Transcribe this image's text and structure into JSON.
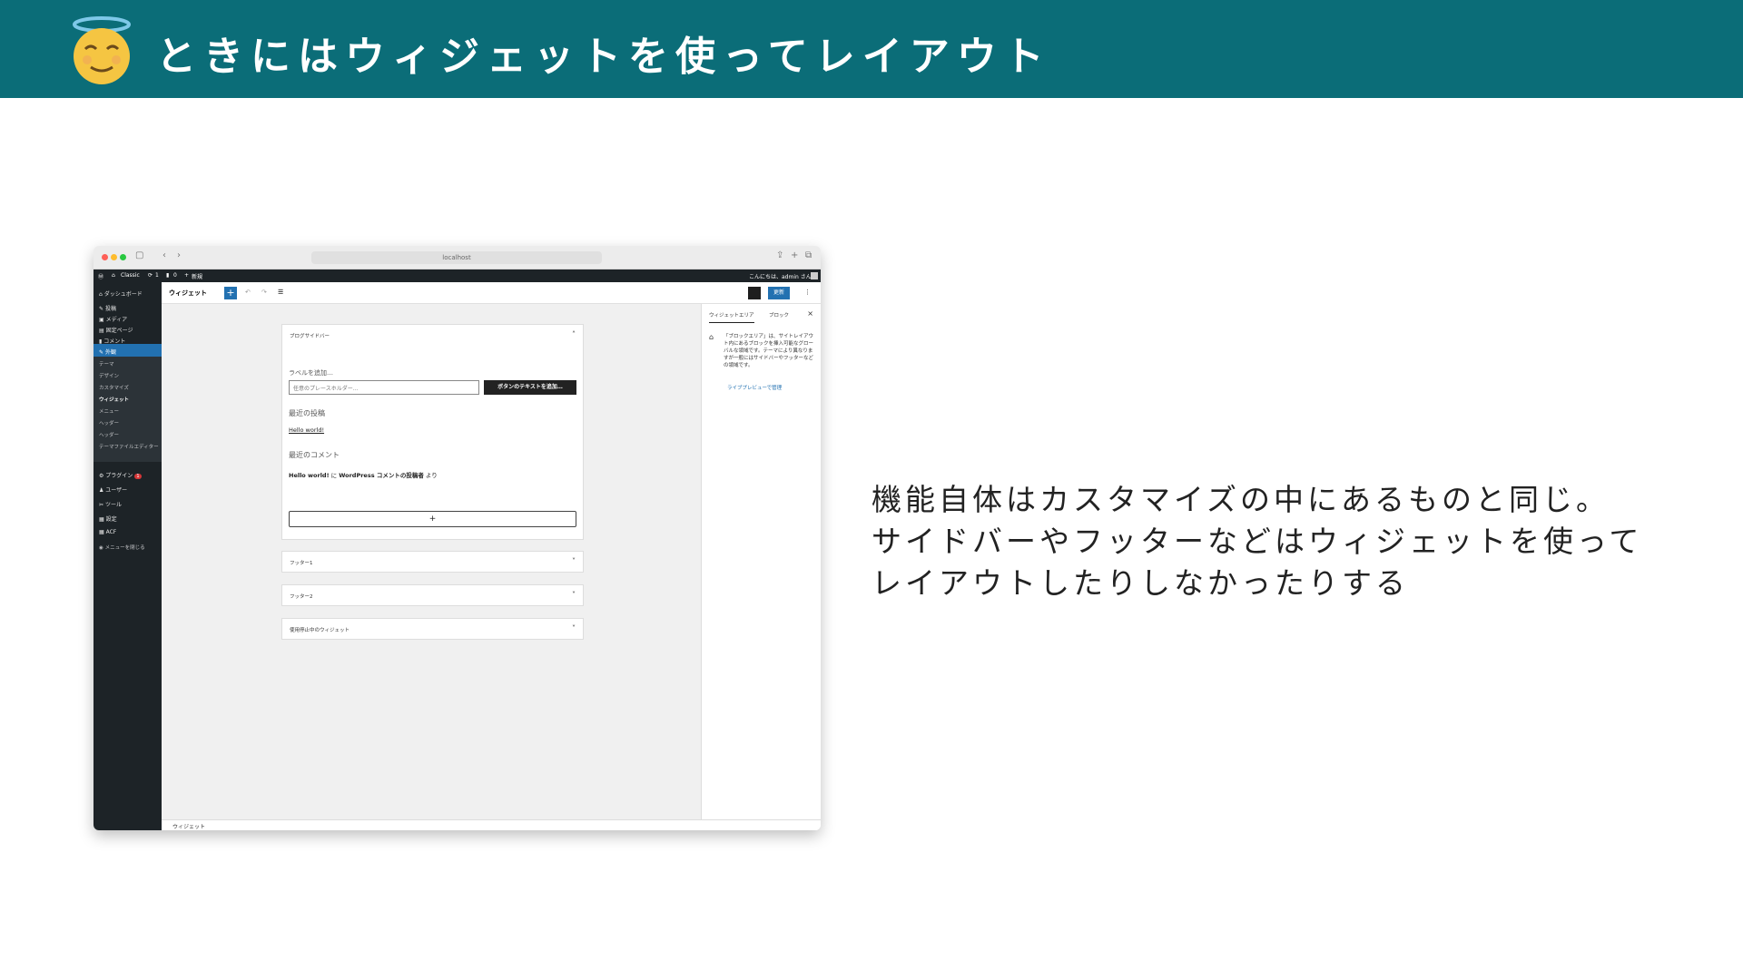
{
  "slide": {
    "title": "ときにはウィジェットを使ってレイアウト",
    "emoji": "innocent-face-emoji",
    "body_lines": [
      "機能自体はカスタマイズの中にあるものと同じ。",
      "サイドバーやフッターなどはウィジェットを使って",
      "レイアウトしたりしなかったりする"
    ],
    "colors": {
      "header_bg": "#0b6d78",
      "title_text": "#ffffff",
      "body_text": "#222222"
    }
  },
  "screenshot": {
    "browser": {
      "url": "localhost"
    },
    "admin_bar": {
      "site_name": "Classic",
      "updates_count": "1",
      "comments_count": "0",
      "new_label": "新規",
      "greeting": "こんにちは、admin さん"
    },
    "sidebar": {
      "dashboard": "ダッシュボード",
      "posts": "投稿",
      "media": "メディア",
      "pages": "固定ページ",
      "comments": "コメント",
      "appearance": "外観",
      "appearance_sub": [
        "テーマ",
        "デザイン",
        "カスタマイズ",
        "ウィジェット",
        "メニュー",
        "ヘッダー",
        "ヘッダー",
        "テーマファイルエディター"
      ],
      "plugins": "プラグイン",
      "plugins_badge": "1",
      "users": "ユーザー",
      "tools": "ツール",
      "settings": "設定",
      "acf": "ACF",
      "collapse": "メニューを閉じる"
    },
    "toolbar": {
      "title": "ウィジェット",
      "save_label": "更新"
    },
    "widget_areas": {
      "blog_sidebar": {
        "title": "ブログサイドバー",
        "search_label": "ラベルを追加…",
        "search_placeholder": "任意のプレースホルダー…",
        "search_button": "ボタンのテキストを追加…",
        "recent_posts_heading": "最近の投稿",
        "recent_post_link": "Hello world!",
        "recent_comments_heading": "最近のコメント",
        "comment_post": "Hello world!",
        "comment_connector": " に ",
        "comment_author": "WordPress コメントの投稿者",
        "comment_suffix": " より",
        "add_block": "+"
      },
      "footer1": "フッター1",
      "footer2": "フッター2",
      "inactive": "使用停止中のウィジェット"
    },
    "panel": {
      "tab_area": "ウィジェットエリア",
      "tab_block": "ブロック",
      "description": "「ブロックエリア」は、サイトレイアウト内にあるブロックを挿入可能なグローバルな領域です。テーマにより異なりますが一般にはサイドバーやフッターなどの領域です。",
      "preview_link": "ライブプレビューで管理"
    },
    "statusbar": "ウィジェット"
  }
}
